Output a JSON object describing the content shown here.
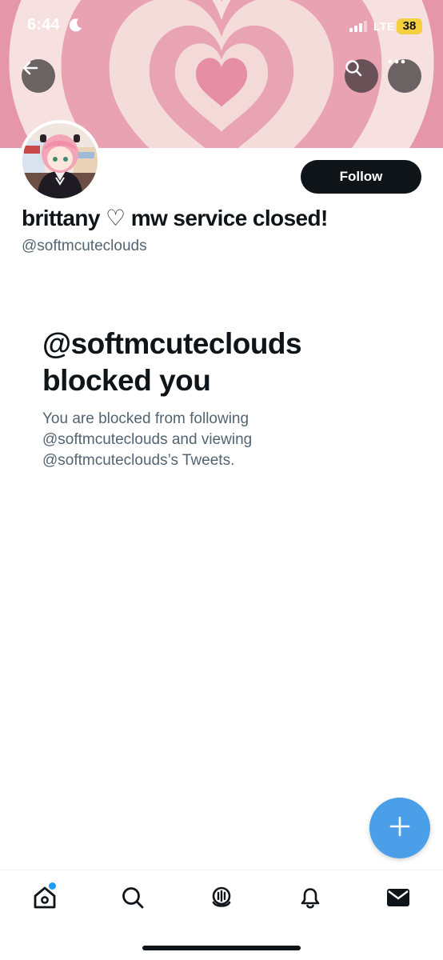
{
  "status_bar": {
    "time": "6:44",
    "network": "LTE",
    "battery": "38"
  },
  "profile": {
    "display_name": "brittany ♡ mw service closed!",
    "handle": "@softmcuteclouds",
    "follow_label": "Follow"
  },
  "blocked": {
    "title": "@softmcuteclouds blocked you",
    "description": "You are blocked from following @softmcuteclouds and viewing @softmcuteclouds’s Tweets."
  },
  "colors": {
    "accent": "#1d9bf0",
    "fab": "#4a9fe8",
    "text_primary": "#0f1419",
    "text_secondary": "#536471",
    "banner_pink": "#e9a2b2",
    "battery": "#f4d03f"
  },
  "icons": {
    "back": "arrow-left-icon",
    "search": "search-icon",
    "more": "more-icon",
    "compose": "plus-icon",
    "nav": [
      "home-icon",
      "search-icon",
      "spaces-icon",
      "bell-icon",
      "mail-icon"
    ]
  }
}
